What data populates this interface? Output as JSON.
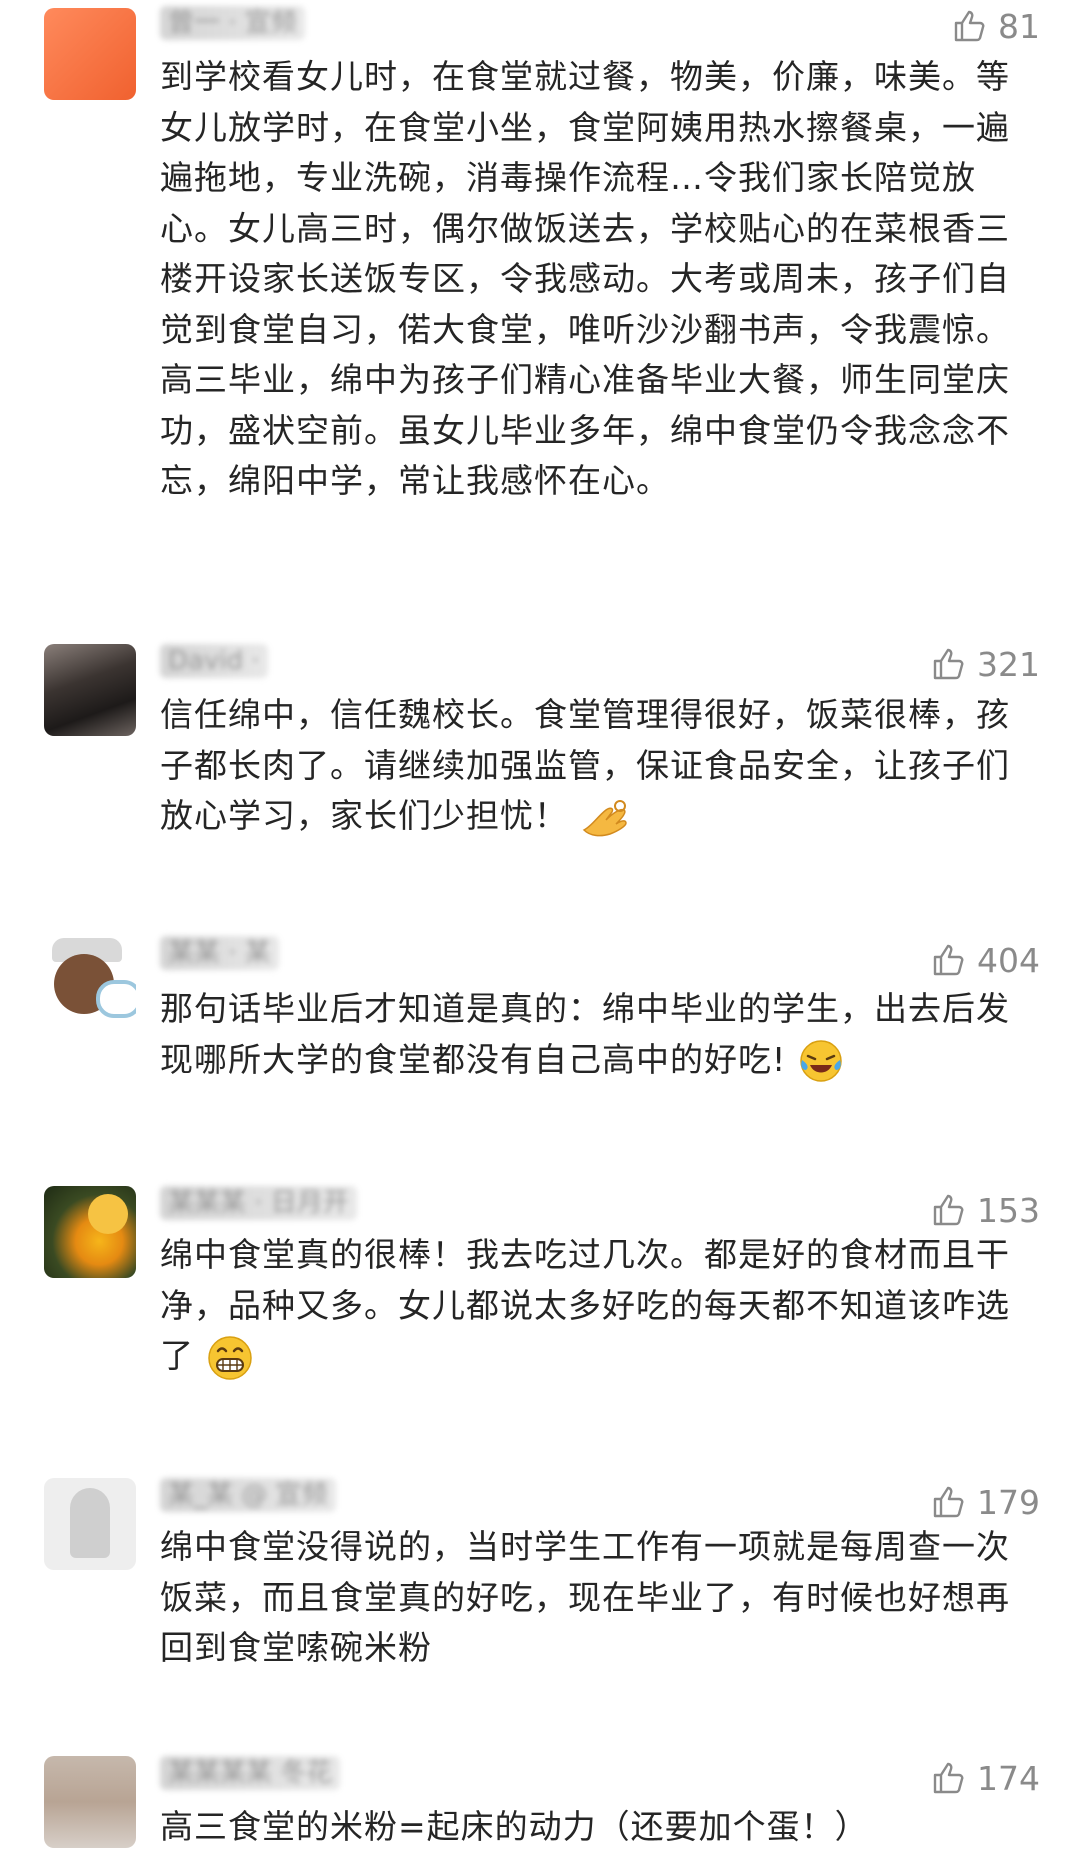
{
  "comments": [
    {
      "username": "曾一 ·  宣频",
      "likes": "81",
      "text": "到学校看女儿时，在食堂就过餐，物美，价廉，味美。等女儿放学时，在食堂小坐，食堂阿姨用热水擦餐桌，一遍遍拖地，专业洗碗，消毒操作流程…令我们家长陪觉放心。女儿高三时，偶尔做饭送去，学校贴心的在菜根香三楼开设家长送饭专区，令我感动。大考或周未，孩子们自觉到食堂自习，偌大食堂，唯听沙沙翻书声，令我震惊。高三毕业，绵中为孩子们精心准备毕业大餐，师生同堂庆功，盛状空前。虽女儿毕业多年，绵中食堂仍令我念念不忘，绵阳中学，常让我感怀在心。"
    },
    {
      "username": "David ·  ",
      "likes": "321",
      "text": "信任绵中，信任魏校长。食堂管理得很好，饭菜很棒，孩子都长肉了。请继续加强监管，保证食品安全，让孩子们放心学习，家长们少担忧！",
      "emoji": "ok-hand-emoji"
    },
    {
      "username": "某某 · 某",
      "likes": "404",
      "text": "那句话毕业后才知道是真的：绵中毕业的学生，出去后发现哪所大学的食堂都没有自己高中的好吃!",
      "emoji": "crying-laughing-emoji"
    },
    {
      "username": "某某某 ·  日月开",
      "likes": "153",
      "text": "绵中食堂真的很棒！我去吃过几次。都是好的食材而且干净，品种又多。女儿都说太多好吃的每天都不知道该咋选了",
      "emoji": "grinning-emoji"
    },
    {
      "username": "某_某 @  宣频",
      "likes": "179",
      "text": "绵中食堂没得说的，当时学生工作有一项就是每周查一次饭菜，而且食堂真的好吃，现在毕业了，有时候也好想再回到食堂嗦碗米粉"
    },
    {
      "username": "某某某某 冬花",
      "likes": "174",
      "text": "高三食堂的米粉=起床的动力（还要加个蛋！）"
    }
  ]
}
